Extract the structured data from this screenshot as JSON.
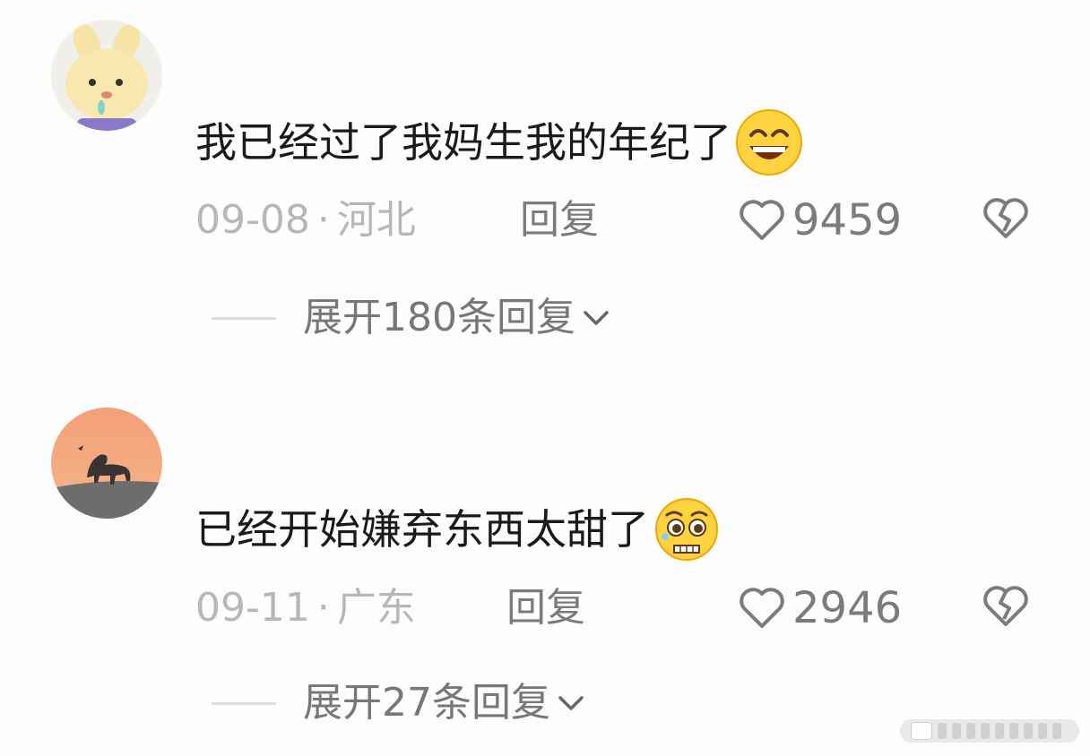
{
  "comments": [
    {
      "avatar_icon": "bunny-avatar-icon",
      "text": "我已经过了我妈生我的年纪了",
      "emoji_icon": "grin-emoji-icon",
      "date": "09-08",
      "separator": "·",
      "location": "河北",
      "reply_label": "回复",
      "likes": "9459",
      "expand_label": "展开180条回复"
    },
    {
      "avatar_icon": "dog-silhouette-avatar-icon",
      "text": "已经开始嫌弃东西太甜了",
      "emoji_icon": "pleading-emoji-icon",
      "date": "09-11",
      "separator": "·",
      "location": "广东",
      "reply_label": "回复",
      "likes": "2946",
      "expand_label": "展开27条回复"
    }
  ],
  "icons": {
    "like": "heart-outline-icon",
    "dislike": "broken-heart-icon",
    "expand": "chevron-down-icon"
  },
  "colors": {
    "text": "#1a1a1a",
    "meta": "#b7b7b7",
    "action": "#7b7b7b"
  }
}
